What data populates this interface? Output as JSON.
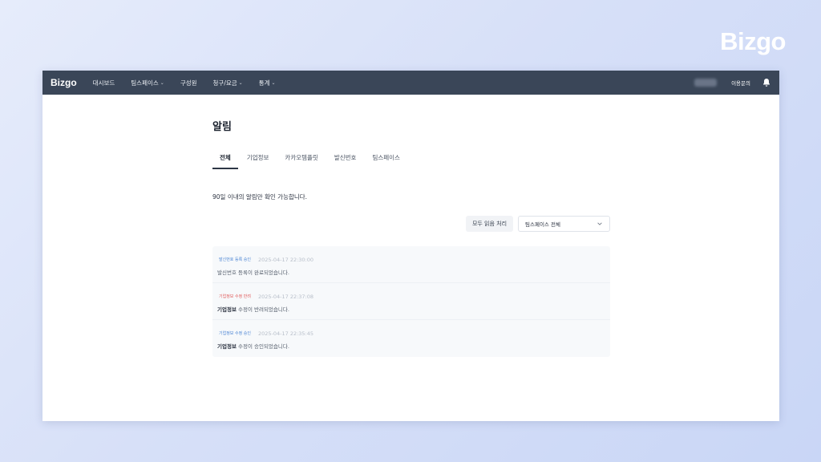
{
  "brand": "Bizgo",
  "nav": {
    "logo": "Bizgo",
    "items": [
      {
        "label": "대시보드",
        "dropdown": false
      },
      {
        "label": "팀스페이스",
        "dropdown": true
      },
      {
        "label": "구성원",
        "dropdown": false
      },
      {
        "label": "청구/요금",
        "dropdown": true
      },
      {
        "label": "통계",
        "dropdown": true
      }
    ],
    "inquiry": "이용문의"
  },
  "page": {
    "title": "알림",
    "tabs": [
      "전체",
      "기업정보",
      "카카오템플릿",
      "발신번호",
      "팀스페이스"
    ],
    "active_tab": 0,
    "notice": "90일 이내의 알림만 확인 가능합니다.",
    "mark_all_label": "모두 읽음 처리",
    "filter_value": "팀스페이스 전체"
  },
  "notifications": [
    {
      "badge": "발신번호 등록 승인",
      "status": "ok",
      "time": "2025-04-17 22:30:00",
      "subject": "",
      "message": "발신번호 등록이 완료되었습니다."
    },
    {
      "badge": "기업정보 수정 반려",
      "status": "reject",
      "time": "2025-04-17 22:37:08",
      "subject": "기업정보",
      "message": " 수정이 반려되었습니다."
    },
    {
      "badge": "기업정보 수정 승인",
      "status": "ok",
      "time": "2025-04-17 22:35:45",
      "subject": "기업정보",
      "message": " 수정이 승인되었습니다."
    }
  ],
  "colors": {
    "nav_bg": "#3a4658",
    "accent_blue": "#4b84d4",
    "reject_red": "#e05a5a"
  }
}
